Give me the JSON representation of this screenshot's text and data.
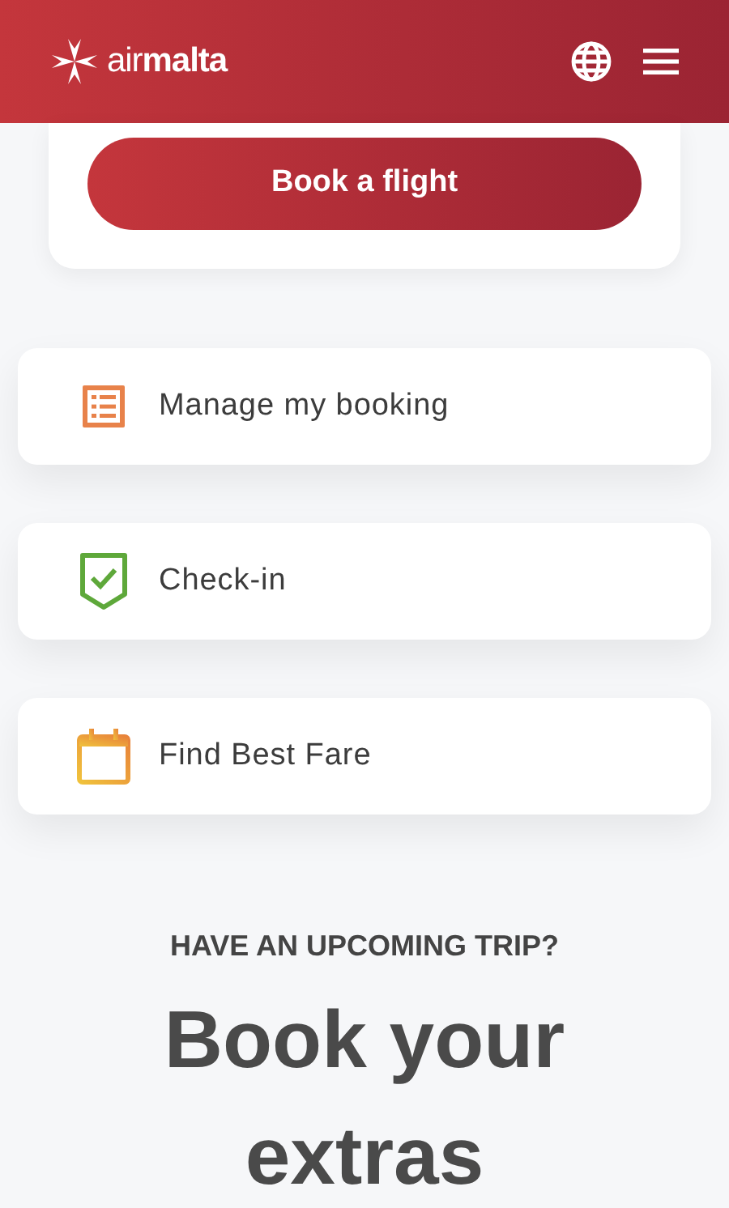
{
  "header": {
    "logo": "air**malta**"
  },
  "booking_card": {
    "button": "Book a flight"
  },
  "actions": [
    {
      "kind": "list",
      "label": "Manage my booking"
    },
    {
      "kind": "check",
      "label": "Check-in"
    },
    {
      "kind": "calendar",
      "label": "Find Best Fare"
    }
  ],
  "extras": {
    "eyebrow": "HAVE AN UPCOMING TRIP?",
    "title": "Book your extras"
  }
}
